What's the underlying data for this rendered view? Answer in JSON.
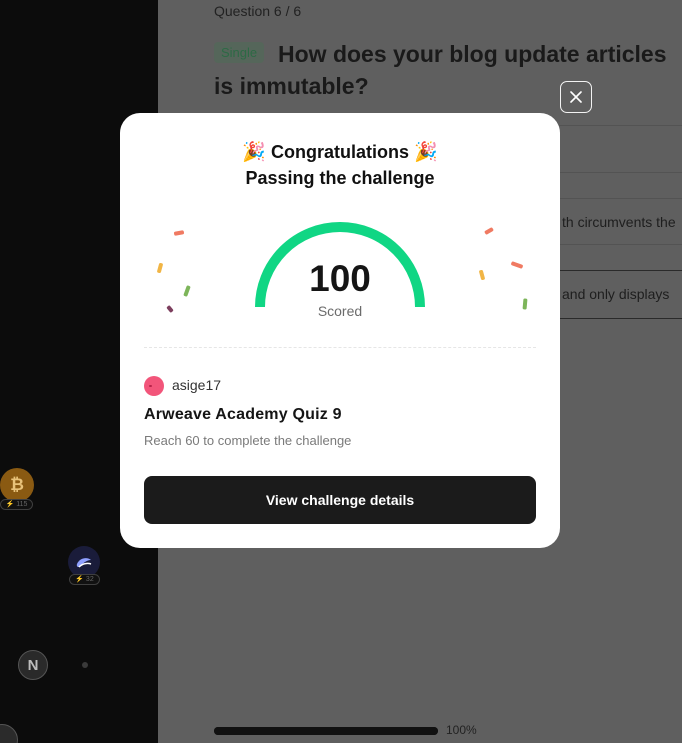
{
  "sidebar": {
    "coins": [
      {
        "icon": "bitcoin-icon",
        "symbol": "₿",
        "badge": "⚡ 115"
      },
      {
        "icon": "sui-icon",
        "symbol": "",
        "badge": "⚡ 32"
      },
      {
        "icon": "near-icon",
        "symbol": "N",
        "badge": ""
      }
    ]
  },
  "quiz_page": {
    "question_counter": "Question 6 / 6",
    "question_type": "Single",
    "question_line1": "How does your blog update articles",
    "question_line2": "is immutable?",
    "option_fragment_1": "th circumvents the",
    "option_fragment_2": "and only displays",
    "progress_percent": 100,
    "progress_label": "100%"
  },
  "modal": {
    "title": "Congratulations",
    "title_icon": "party-popper-icon",
    "title_emoji": "🎉",
    "subtitle": "Passing the challenge",
    "score": "100",
    "score_fraction": 1.0,
    "score_label": "Scored",
    "author": "asige17",
    "quiz_name": "Arweave Academy Quiz 9",
    "requirement": "Reach 60 to complete the challenge",
    "button_label": "View challenge details",
    "colors": {
      "gauge": "#10d684",
      "button": "#1b1b1b",
      "avatar": "#f2557a",
      "confetti": [
        "#f07a62",
        "#f1b545",
        "#7db55a",
        "#7d3f5e"
      ]
    }
  }
}
